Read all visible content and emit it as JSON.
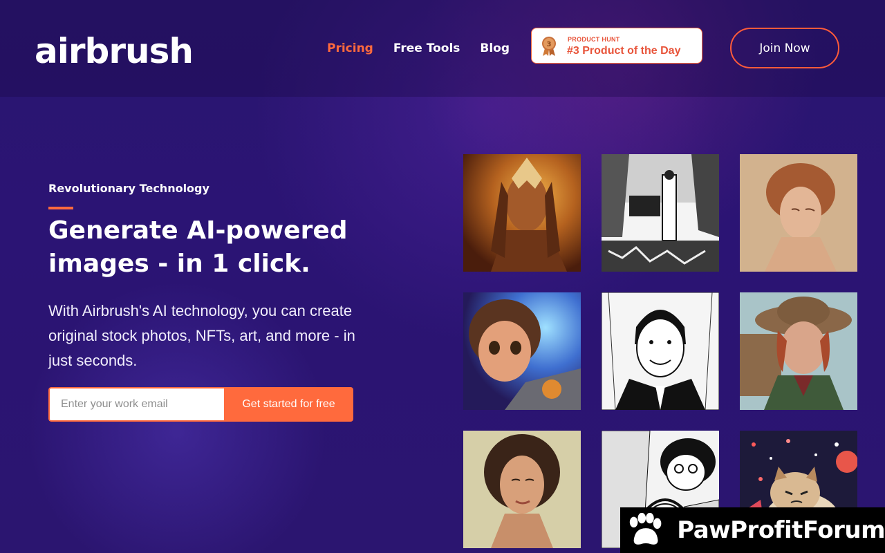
{
  "brand": {
    "logo_text": "airbrush"
  },
  "nav": {
    "items": [
      {
        "label": "Pricing",
        "active": true
      },
      {
        "label": "Free Tools",
        "active": false
      },
      {
        "label": "Blog",
        "active": false
      }
    ]
  },
  "product_hunt": {
    "small_label": "PRODUCT HUNT",
    "title": "#3 Product of the Day",
    "medal_number": "3"
  },
  "header": {
    "join_label": "Join Now"
  },
  "hero": {
    "eyebrow": "Revolutionary Technology",
    "headline": "Generate AI-powered images - in 1 click.",
    "subtext": "With Airbrush's AI technology, you can create original stock photos, NFTs, art, and more - in just seconds.",
    "email_placeholder": "Enter your work email",
    "cta_label": "Get started for free"
  },
  "gallery": {
    "images": [
      {
        "name": "golden-warrior-portrait"
      },
      {
        "name": "ink-kitchen-scene"
      },
      {
        "name": "redhead-woman-portrait"
      },
      {
        "name": "cartoon-hero-girl"
      },
      {
        "name": "ink-man-portrait"
      },
      {
        "name": "woman-in-hat"
      },
      {
        "name": "brunette-woman-portrait"
      },
      {
        "name": "manga-couple"
      },
      {
        "name": "grumpy-cat-fireworks"
      }
    ]
  },
  "watermark": {
    "text": "PawProfitForum"
  },
  "colors": {
    "accent": "#ff6a3d",
    "background": "#2b1574"
  }
}
